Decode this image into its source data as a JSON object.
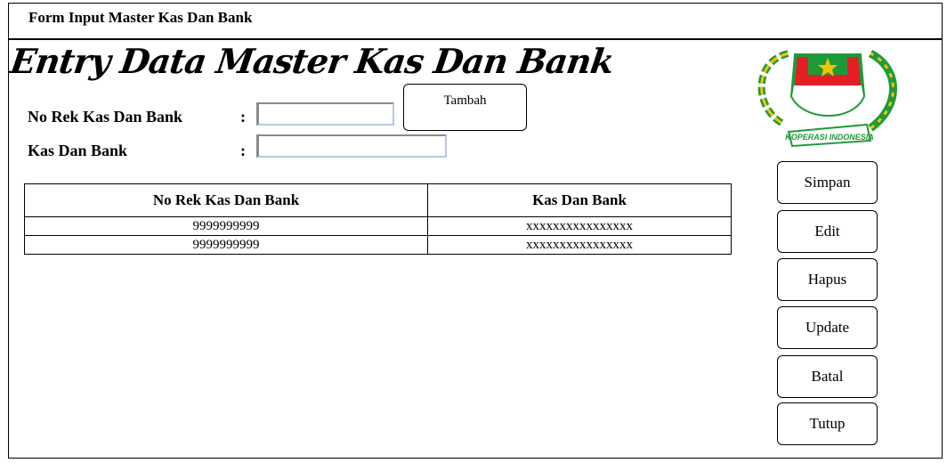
{
  "window": {
    "title": "Form Input Master Kas Dan Bank"
  },
  "heading": "Entry Data Master Kas Dan Bank",
  "form": {
    "fields": [
      {
        "label": "No Rek Kas Dan Bank",
        "colon": ":",
        "value": ""
      },
      {
        "label": "Kas Dan Bank",
        "colon": ":",
        "value": ""
      }
    ],
    "add_button": "Tambah"
  },
  "table": {
    "headers": [
      "No Rek Kas Dan Bank",
      "Kas Dan Bank"
    ],
    "rows": [
      [
        "9999999999",
        "xxxxxxxxxxxxxxxx"
      ],
      [
        "9999999999",
        "xxxxxxxxxxxxxxxx"
      ]
    ]
  },
  "actions": {
    "save": "Simpan",
    "edit": "Edit",
    "delete": "Hapus",
    "update": "Update",
    "cancel": "Batal",
    "close": "Tutup"
  },
  "logo": {
    "icon": "koperasi-indonesia-emblem",
    "text": "KOPERASI INDONESIA"
  },
  "colors": {
    "logo_red": "#e31e24",
    "logo_green": "#1f9a3a",
    "logo_yellow": "#f2c400"
  }
}
